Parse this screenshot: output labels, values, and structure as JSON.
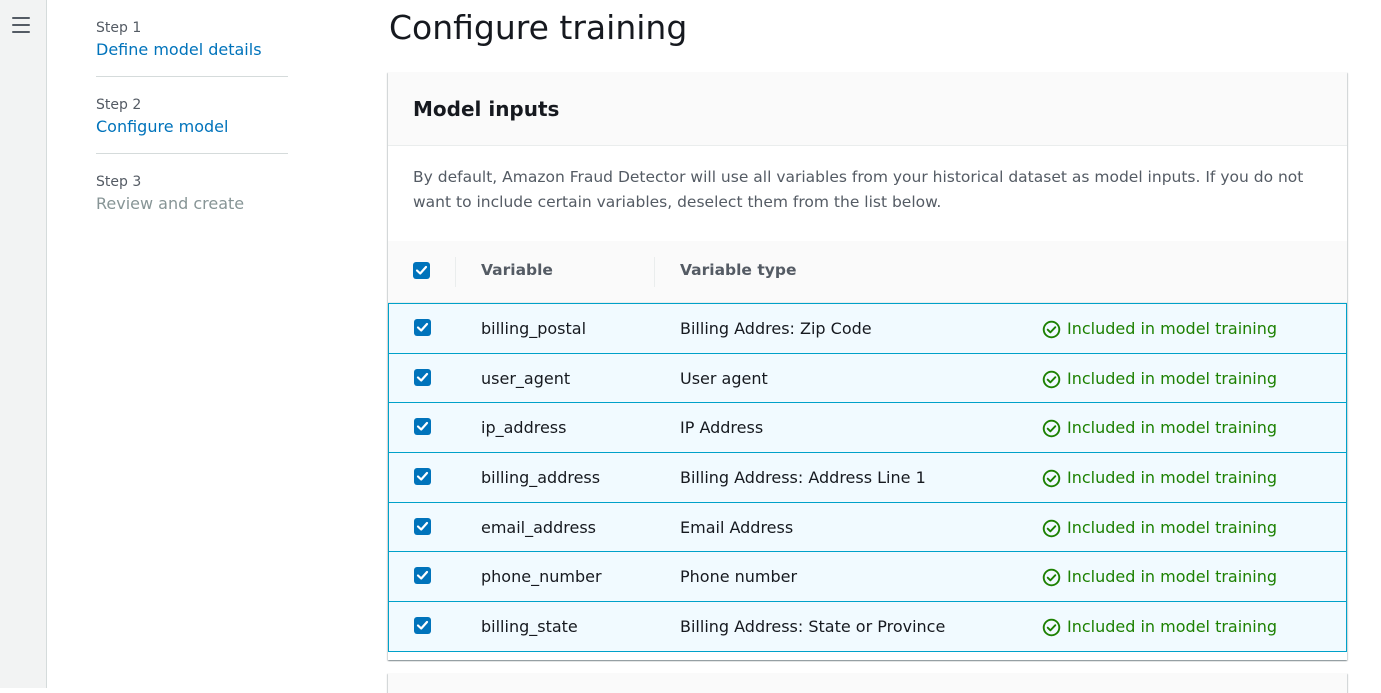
{
  "steps": [
    {
      "number": "Step 1",
      "label": "Define model details",
      "state": "link"
    },
    {
      "number": "Step 2",
      "label": "Configure model",
      "state": "link"
    },
    {
      "number": "Step 3",
      "label": "Review and create",
      "state": "disabled"
    }
  ],
  "page_title": "Configure training",
  "panel": {
    "title": "Model inputs",
    "description": "By default, Amazon Fraud Detector will use all variables from your historical dataset as model inputs. If you do not want to include certain variables, deselect them from the list below.",
    "header_checked": true,
    "columns": {
      "variable": "Variable",
      "type": "Variable type"
    },
    "rows": [
      {
        "variable": "billing_postal",
        "type": "Billing Addres: Zip Code",
        "status": "Included in model training",
        "checked": true
      },
      {
        "variable": "user_agent",
        "type": "User agent",
        "status": "Included in model training",
        "checked": true
      },
      {
        "variable": "ip_address",
        "type": "IP Address",
        "status": "Included in model training",
        "checked": true
      },
      {
        "variable": "billing_address",
        "type": "Billing Address: Address Line 1",
        "status": "Included in model training",
        "checked": true
      },
      {
        "variable": "email_address",
        "type": "Email Address",
        "status": "Included in model training",
        "checked": true
      },
      {
        "variable": "phone_number",
        "type": "Phone number",
        "status": "Included in model training",
        "checked": true
      },
      {
        "variable": "billing_state",
        "type": "Billing Address: State or Province",
        "status": "Included in model training",
        "checked": true
      }
    ]
  },
  "colors": {
    "accent": "#0073bb",
    "success": "#1d8102",
    "row_selected_bg": "#f1faff",
    "row_selected_border": "#00a1c9"
  },
  "icons": {
    "menu": "hamburger-icon",
    "check": "checkmark-icon",
    "status": "check-circle-icon"
  }
}
